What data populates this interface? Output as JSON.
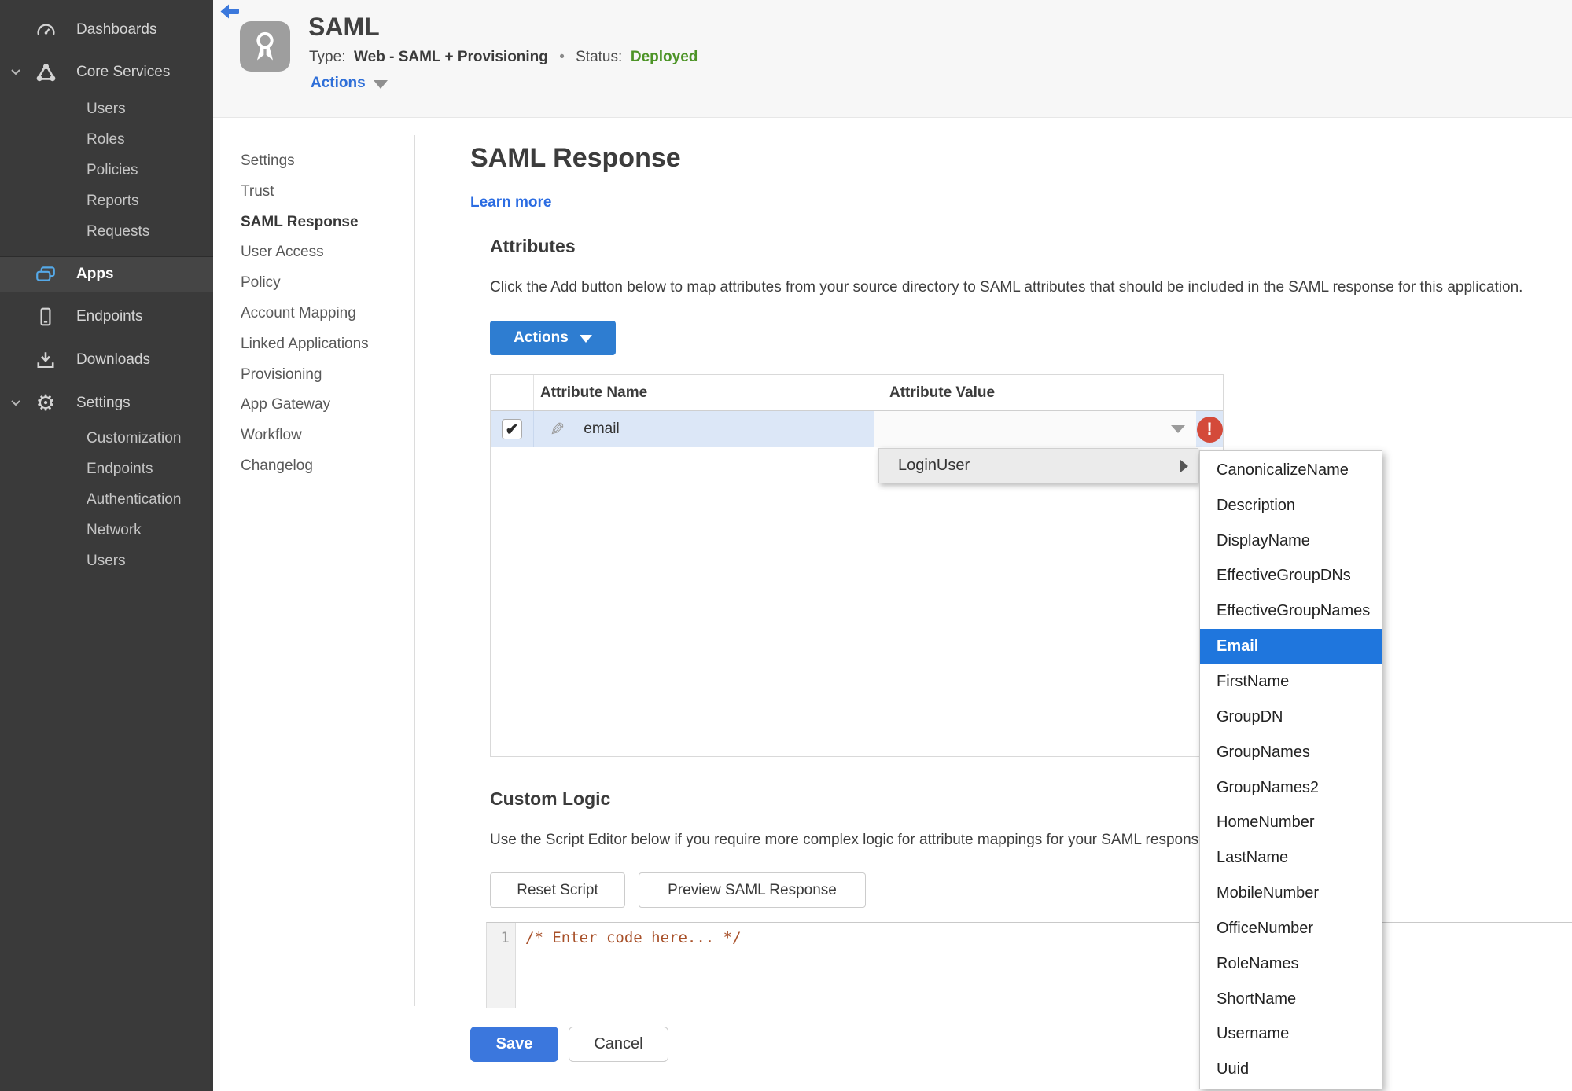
{
  "sidebar": {
    "items": [
      {
        "label": "Dashboards",
        "icon": "gauge-icon"
      },
      {
        "label": "Core Services",
        "icon": "core-services-icon",
        "expanded": true,
        "children": [
          "Users",
          "Roles",
          "Policies",
          "Reports",
          "Requests"
        ]
      },
      {
        "label": "Apps",
        "icon": "apps-icon",
        "active": true
      },
      {
        "label": "Endpoints",
        "icon": "mobile-device-icon"
      },
      {
        "label": "Downloads",
        "icon": "download-icon"
      },
      {
        "label": "Settings",
        "icon": "gear-icon",
        "expanded": true,
        "children": [
          "Customization",
          "Endpoints",
          "Authentication",
          "Network",
          "Users"
        ]
      }
    ]
  },
  "header": {
    "title": "SAML",
    "type_label": "Type:",
    "type_value": "Web - SAML + Provisioning",
    "separator": "•",
    "status_label": "Status:",
    "status_value": "Deployed",
    "actions_label": "Actions",
    "icons": {
      "back": "back-arrow-icon",
      "app": "award-ribbon-icon"
    }
  },
  "subnav": {
    "active_item": "SAML Response",
    "items": [
      "Settings",
      "Trust",
      "SAML Response",
      "User Access",
      "Policy",
      "Account Mapping",
      "Linked Applications",
      "Provisioning",
      "App Gateway",
      "Workflow",
      "Changelog"
    ]
  },
  "main": {
    "title": "SAML Response",
    "learn_more": "Learn more",
    "attributes": {
      "heading": "Attributes",
      "description": "Click the Add button below to map attributes from your source directory to SAML attributes that should be included in the SAML response for this application.",
      "actions_button": "Actions",
      "table": {
        "columns": [
          "Attribute Name",
          "Attribute Value"
        ],
        "rows": [
          {
            "checked": true,
            "name": "email",
            "value": "",
            "error": true
          }
        ]
      }
    },
    "dropdown_menu": {
      "parent_item": "LoginUser",
      "selected_item": "Email",
      "items": [
        "CanonicalizeName",
        "Description",
        "DisplayName",
        "EffectiveGroupDNs",
        "EffectiveGroupNames",
        "Email",
        "FirstName",
        "GroupDN",
        "GroupNames",
        "GroupNames2",
        "HomeNumber",
        "LastName",
        "MobileNumber",
        "OfficeNumber",
        "RoleNames",
        "ShortName",
        "Username",
        "Uuid"
      ]
    },
    "custom_logic": {
      "heading": "Custom Logic",
      "description": "Use the Script Editor below if you require more complex logic for attribute mappings for your SAML response.",
      "reset_button": "Reset Script",
      "preview_button": "Preview SAML Response",
      "editor": {
        "line_number": "1",
        "code": "/* Enter code here... */"
      }
    },
    "footer": {
      "save_button": "Save",
      "cancel_button": "Cancel"
    }
  },
  "colors": {
    "accent_blue": "#2e7dd1",
    "link_blue": "#2b6ce2",
    "selected_blue": "#1f76dd",
    "row_highlight_blue": "#dce7f7",
    "status_green": "#4d9427",
    "error_red": "#d44a3a",
    "sidebar_bg": "#3a3a3a",
    "code_text": "#a8512a"
  }
}
